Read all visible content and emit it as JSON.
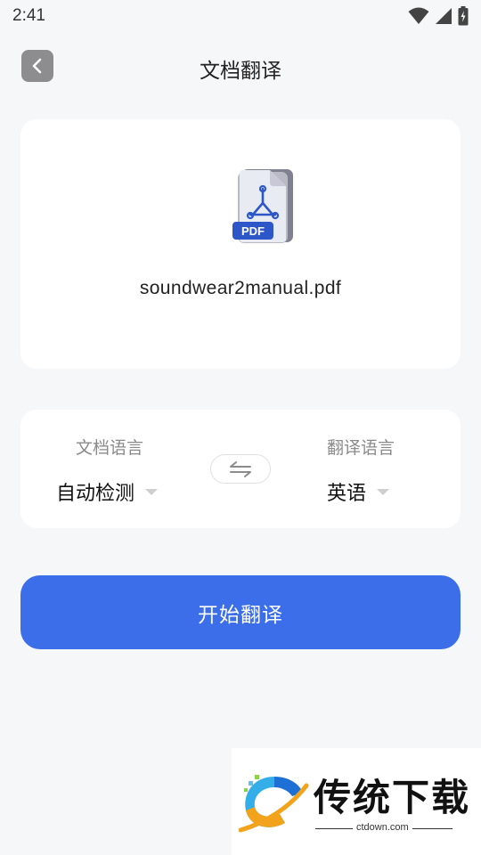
{
  "status_bar": {
    "time": "2:41"
  },
  "header": {
    "title": "文档翻译",
    "back_icon": "chevron-left-icon"
  },
  "file_card": {
    "file_name": "soundwear2manual.pdf",
    "icon": "pdf-file-icon",
    "badge": "PDF"
  },
  "language_card": {
    "source_label": "文档语言",
    "source_value": "自动检测",
    "target_label": "翻译语言",
    "target_value": "英语",
    "swap_icon": "swap-arrows-icon"
  },
  "start_button": {
    "label": "开始翻译"
  },
  "watermark": {
    "brand": "传统下载",
    "domain": "ctdown.com"
  },
  "colors": {
    "accent": "#3b6ee8",
    "background": "#f6f7f9",
    "card": "#ffffff"
  }
}
